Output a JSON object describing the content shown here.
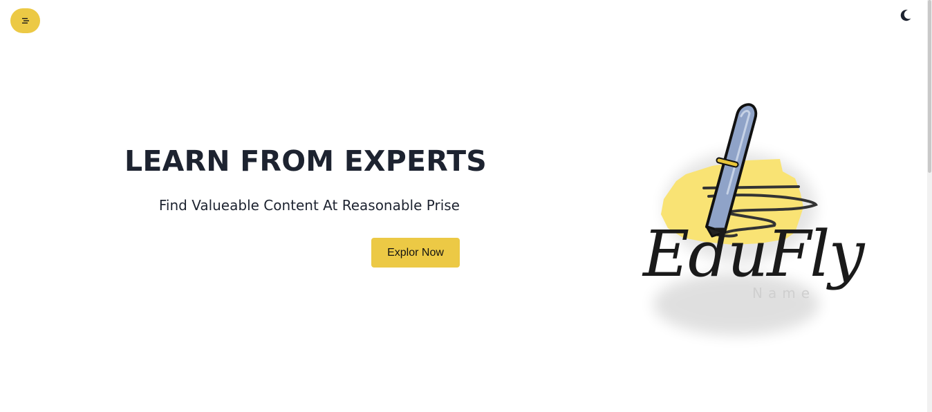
{
  "header": {
    "menu_icon": "hamburger-icon",
    "theme_icon": "moon-icon"
  },
  "hero": {
    "title": "LEARN FROM EXPERTS",
    "subtitle": "Find Valueable Content At Reasonable Prise",
    "cta_label": "Explor Now"
  },
  "logo": {
    "script_text": "EduFly",
    "name_text": "Name",
    "icon": "pen-icon"
  },
  "colors": {
    "accent": "#ecc945",
    "text": "#1d2330",
    "pen_body": "#8fa3c8"
  }
}
